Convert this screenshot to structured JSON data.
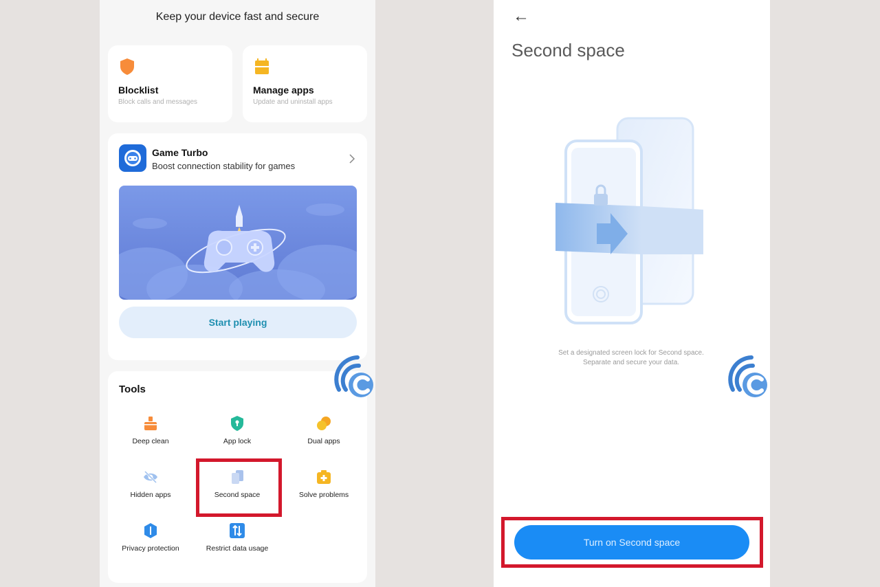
{
  "left": {
    "header": "Keep your device fast and secure",
    "blocklist": {
      "title": "Blocklist",
      "subtitle": "Block calls and messages"
    },
    "manage_apps": {
      "title": "Manage apps",
      "subtitle": "Update and uninstall apps"
    },
    "game_turbo": {
      "title": "Game Turbo",
      "subtitle": "Boost connection stability for games",
      "button": "Start playing"
    },
    "tools": {
      "title": "Tools",
      "items": [
        {
          "label": "Deep clean",
          "icon": "broom-icon"
        },
        {
          "label": "App lock",
          "icon": "shield-lock-icon"
        },
        {
          "label": "Dual apps",
          "icon": "dual-circles-icon"
        },
        {
          "label": "Hidden apps",
          "icon": "eye-slash-icon"
        },
        {
          "label": "Second space",
          "icon": "layers-icon"
        },
        {
          "label": "Solve problems",
          "icon": "first-aid-icon"
        },
        {
          "label": "Privacy protection",
          "icon": "privacy-shield-icon"
        },
        {
          "label": "Restrict data usage",
          "icon": "data-arrows-icon"
        }
      ]
    }
  },
  "right": {
    "title": "Second space",
    "description_line1": "Set a designated screen lock for Second space.",
    "description_line2": "Separate and secure your data.",
    "button": "Turn on Second space"
  },
  "colors": {
    "highlight": "#d3182c",
    "primary_button": "#1a8cf5",
    "accent_orange": "#f78c3a",
    "accent_yellow": "#f5b623",
    "accent_green": "#25b99a",
    "accent_blue": "#2f8be8"
  }
}
